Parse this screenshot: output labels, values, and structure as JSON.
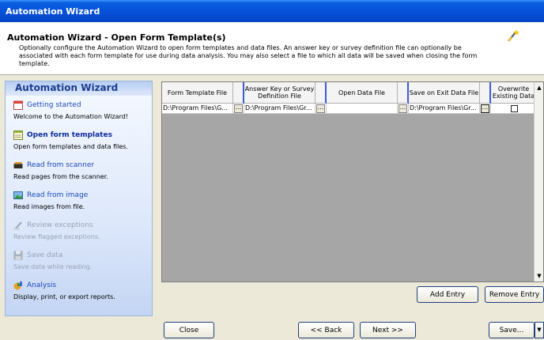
{
  "window": {
    "title": "Automation Wizard"
  },
  "header": {
    "title": "Automation Wizard - Open Form Template(s)",
    "description": "Optionally configure the Automation Wizard to open form templates and data files. An answer key or survey definition file can optionally be associated with each form template for use during data analysis. You may also select a file to which all data will be saved when closing the form template.",
    "icon": "magic-wand-icon"
  },
  "sidebar": {
    "title": "Automation Wizard",
    "items": [
      {
        "label": "Getting started",
        "desc": "Welcome to the Automation Wizard!",
        "icon": "calendar-icon",
        "state": "normal"
      },
      {
        "label": "Open form templates",
        "desc": "Open form templates and data files.",
        "icon": "form-icon",
        "state": "active"
      },
      {
        "label": "Read from scanner",
        "desc": "Read pages from the scanner.",
        "icon": "scanner-icon",
        "state": "normal"
      },
      {
        "label": "Read from image",
        "desc": "Read images from file.",
        "icon": "image-icon",
        "state": "normal"
      },
      {
        "label": "Review exceptions",
        "desc": "Review flagged exceptions.",
        "icon": "pen-icon",
        "state": "disabled"
      },
      {
        "label": "Save data",
        "desc": "Save data while reading.",
        "icon": "save-icon",
        "state": "disabled"
      },
      {
        "label": "Analysis",
        "desc": "Display, print, or export reports.",
        "icon": "analysis-icon",
        "state": "normal"
      }
    ]
  },
  "grid": {
    "columns": [
      "Form Template File",
      "Answer Key or Survey Definition File",
      "Open Data File",
      "Save on Exit Data File",
      "Overwrite Existing Data"
    ],
    "rows": [
      {
        "template": "D:\\Program Files\\G...",
        "answer_key": "D:\\Program Files\\Gr...",
        "open_data": "",
        "save_exit": "D:\\Program Files\\Gr...",
        "overwrite": false
      }
    ],
    "browse_label": "..."
  },
  "buttons": {
    "add_entry": "Add Entry",
    "remove_entry": "Remove Entry",
    "close": "Close",
    "back": "<< Back",
    "next": "Next >>",
    "save": "Save..."
  }
}
